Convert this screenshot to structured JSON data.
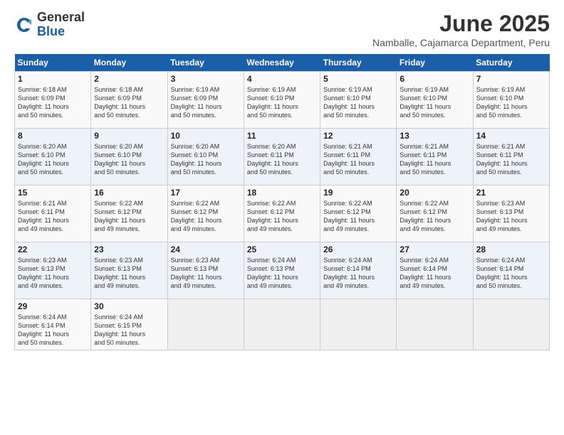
{
  "logo": {
    "general": "General",
    "blue": "Blue"
  },
  "title": "June 2025",
  "subtitle": "Namballe, Cajamarca Department, Peru",
  "days_of_week": [
    "Sunday",
    "Monday",
    "Tuesday",
    "Wednesday",
    "Thursday",
    "Friday",
    "Saturday"
  ],
  "weeks": [
    [
      {
        "day": "1",
        "sunrise": "6:18 AM",
        "sunset": "6:09 PM",
        "daylight": "11 hours and 50 minutes."
      },
      {
        "day": "2",
        "sunrise": "6:18 AM",
        "sunset": "6:09 PM",
        "daylight": "11 hours and 50 minutes."
      },
      {
        "day": "3",
        "sunrise": "6:19 AM",
        "sunset": "6:09 PM",
        "daylight": "11 hours and 50 minutes."
      },
      {
        "day": "4",
        "sunrise": "6:19 AM",
        "sunset": "6:10 PM",
        "daylight": "11 hours and 50 minutes."
      },
      {
        "day": "5",
        "sunrise": "6:19 AM",
        "sunset": "6:10 PM",
        "daylight": "11 hours and 50 minutes."
      },
      {
        "day": "6",
        "sunrise": "6:19 AM",
        "sunset": "6:10 PM",
        "daylight": "11 hours and 50 minutes."
      },
      {
        "day": "7",
        "sunrise": "6:19 AM",
        "sunset": "6:10 PM",
        "daylight": "11 hours and 50 minutes."
      }
    ],
    [
      {
        "day": "8",
        "sunrise": "6:20 AM",
        "sunset": "6:10 PM",
        "daylight": "11 hours and 50 minutes."
      },
      {
        "day": "9",
        "sunrise": "6:20 AM",
        "sunset": "6:10 PM",
        "daylight": "11 hours and 50 minutes."
      },
      {
        "day": "10",
        "sunrise": "6:20 AM",
        "sunset": "6:10 PM",
        "daylight": "11 hours and 50 minutes."
      },
      {
        "day": "11",
        "sunrise": "6:20 AM",
        "sunset": "6:11 PM",
        "daylight": "11 hours and 50 minutes."
      },
      {
        "day": "12",
        "sunrise": "6:21 AM",
        "sunset": "6:11 PM",
        "daylight": "11 hours and 50 minutes."
      },
      {
        "day": "13",
        "sunrise": "6:21 AM",
        "sunset": "6:11 PM",
        "daylight": "11 hours and 50 minutes."
      },
      {
        "day": "14",
        "sunrise": "6:21 AM",
        "sunset": "6:11 PM",
        "daylight": "11 hours and 50 minutes."
      }
    ],
    [
      {
        "day": "15",
        "sunrise": "6:21 AM",
        "sunset": "6:11 PM",
        "daylight": "11 hours and 49 minutes."
      },
      {
        "day": "16",
        "sunrise": "6:22 AM",
        "sunset": "6:12 PM",
        "daylight": "11 hours and 49 minutes."
      },
      {
        "day": "17",
        "sunrise": "6:22 AM",
        "sunset": "6:12 PM",
        "daylight": "11 hours and 49 minutes."
      },
      {
        "day": "18",
        "sunrise": "6:22 AM",
        "sunset": "6:12 PM",
        "daylight": "11 hours and 49 minutes."
      },
      {
        "day": "19",
        "sunrise": "6:22 AM",
        "sunset": "6:12 PM",
        "daylight": "11 hours and 49 minutes."
      },
      {
        "day": "20",
        "sunrise": "6:22 AM",
        "sunset": "6:12 PM",
        "daylight": "11 hours and 49 minutes."
      },
      {
        "day": "21",
        "sunrise": "6:23 AM",
        "sunset": "6:13 PM",
        "daylight": "11 hours and 49 minutes."
      }
    ],
    [
      {
        "day": "22",
        "sunrise": "6:23 AM",
        "sunset": "6:13 PM",
        "daylight": "11 hours and 49 minutes."
      },
      {
        "day": "23",
        "sunrise": "6:23 AM",
        "sunset": "6:13 PM",
        "daylight": "11 hours and 49 minutes."
      },
      {
        "day": "24",
        "sunrise": "6:23 AM",
        "sunset": "6:13 PM",
        "daylight": "11 hours and 49 minutes."
      },
      {
        "day": "25",
        "sunrise": "6:24 AM",
        "sunset": "6:13 PM",
        "daylight": "11 hours and 49 minutes."
      },
      {
        "day": "26",
        "sunrise": "6:24 AM",
        "sunset": "6:14 PM",
        "daylight": "11 hours and 49 minutes."
      },
      {
        "day": "27",
        "sunrise": "6:24 AM",
        "sunset": "6:14 PM",
        "daylight": "11 hours and 49 minutes."
      },
      {
        "day": "28",
        "sunrise": "6:24 AM",
        "sunset": "6:14 PM",
        "daylight": "11 hours and 50 minutes."
      }
    ],
    [
      {
        "day": "29",
        "sunrise": "6:24 AM",
        "sunset": "6:14 PM",
        "daylight": "11 hours and 50 minutes."
      },
      {
        "day": "30",
        "sunrise": "6:24 AM",
        "sunset": "6:15 PM",
        "daylight": "11 hours and 50 minutes."
      },
      null,
      null,
      null,
      null,
      null
    ]
  ]
}
